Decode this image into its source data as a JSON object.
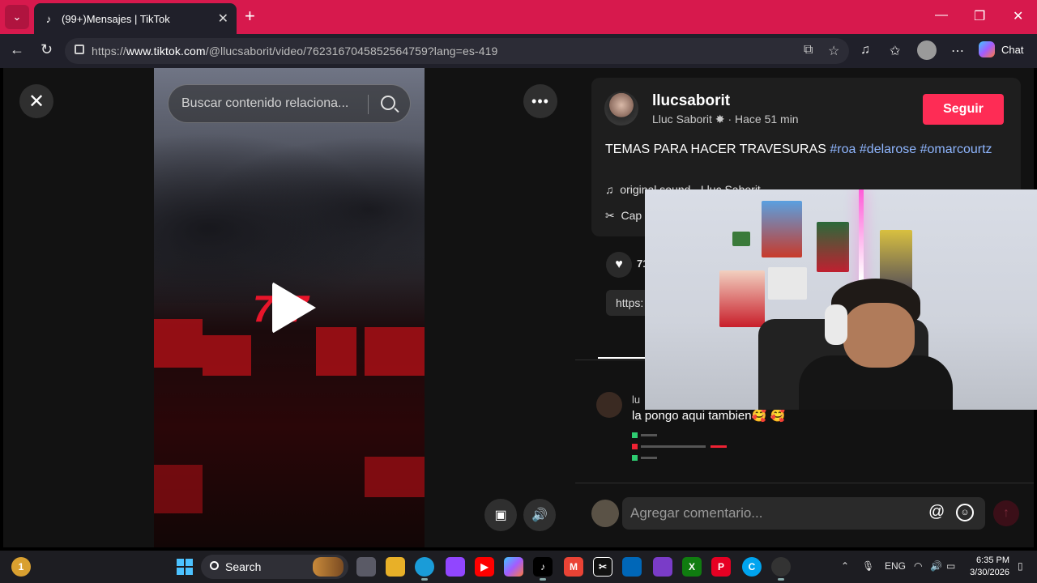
{
  "browser": {
    "tab_title": "(99+)Mensajes | TikTok",
    "tab_icon": "tiktok-icon",
    "url_host": "www.tiktok.com",
    "url_prefix": "https://",
    "url_path": "/@llucsaborit/video/7623167045852564759?lang=es-419",
    "chat_label": "Chat",
    "accent": "#d7194d"
  },
  "video": {
    "search_placeholder": "Buscar contenido relaciona...",
    "overlay_text": "777"
  },
  "post": {
    "username": "llucsaborit",
    "nickname": "Lluc Saborit",
    "time_ago": "· Hace 51 min",
    "follow_label": "Seguir",
    "description": "TEMAS PARA HACER TRAVESURAS",
    "hashtags": [
      "#roa",
      "#delarose",
      "#omarcourtz"
    ],
    "music": "original sound - Lluc Saborit",
    "capcut": "Cap",
    "like_count": "71",
    "link_text": "https:"
  },
  "comments": [
    {
      "user": "lu",
      "text": "la pongo aqui tambien🥰 🥰"
    }
  ],
  "comment_input": {
    "placeholder": "Agregar comentario..."
  },
  "taskbar": {
    "search_label": "Search",
    "language": "ENG",
    "time": "6:35 PM",
    "date": "3/30/2026",
    "weather_badge": "1"
  }
}
